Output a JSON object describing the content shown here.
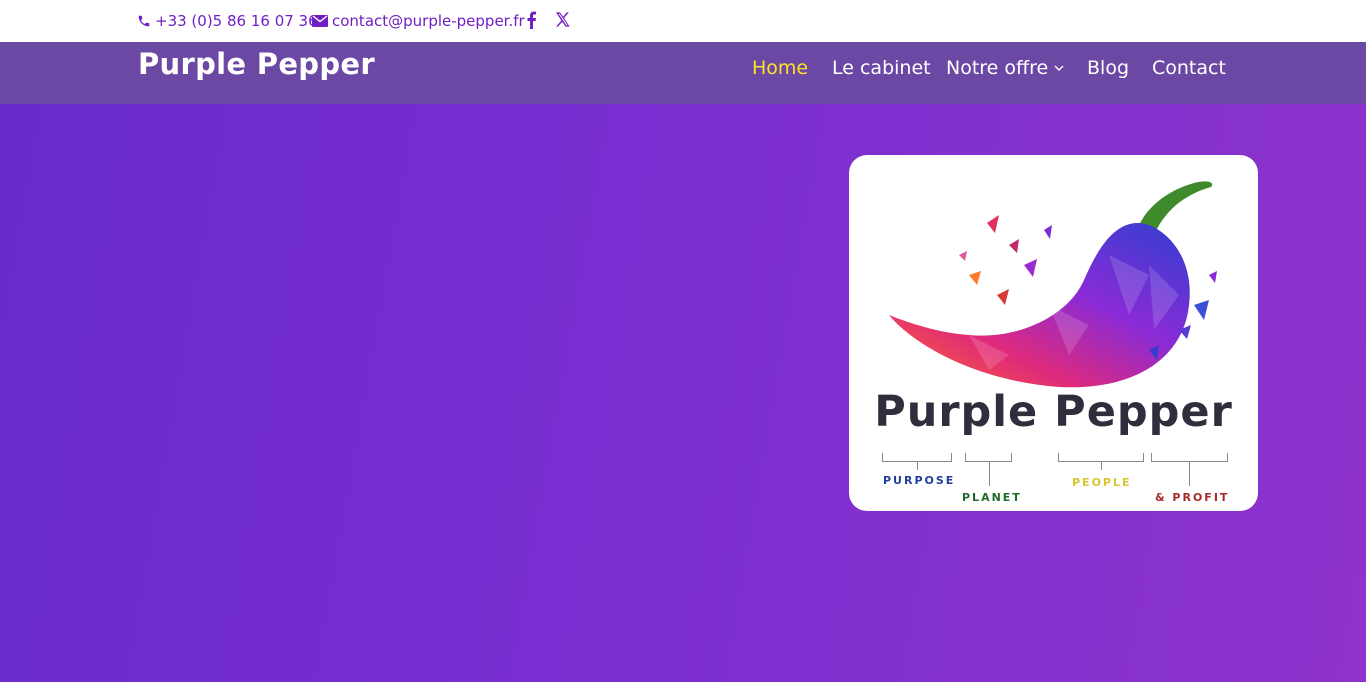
{
  "topbar": {
    "phone": "+33 (0)5 86 16 07 36",
    "email": "contact@purple-pepper.fr",
    "social": [
      "facebook-icon",
      "x-icon"
    ]
  },
  "header": {
    "logo": "Purple Pepper",
    "nav": [
      {
        "label": "Home",
        "active": true
      },
      {
        "label": "Le cabinet"
      },
      {
        "label": "Notre offre",
        "dropdown": true
      },
      {
        "label": "Blog"
      },
      {
        "label": "Contact"
      }
    ]
  },
  "hero": {
    "image": {
      "title": "Purple Pepper",
      "tags": [
        "PURPOSE",
        "PLANET",
        "PEOPLE",
        "& PROFIT"
      ],
      "tag_colors": [
        "#1f3f9c",
        "#1f6b2b",
        "#d6c72a",
        "#a32a2a"
      ]
    }
  },
  "colors": {
    "accent": "#ffe226",
    "brand": "#6f1fc4",
    "header_bg": "#6b48a3"
  }
}
